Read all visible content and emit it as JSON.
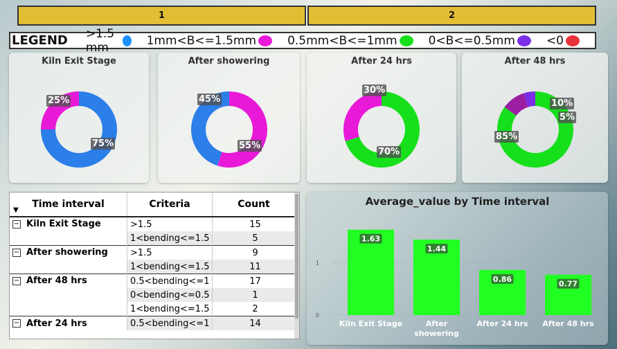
{
  "tabs": [
    "1",
    "2"
  ],
  "legend": {
    "title": "LEGEND",
    "items": [
      {
        "label": ">1.5 mm",
        "color": "#1e90ff",
        "icon": "blue-dot-icon"
      },
      {
        "label": "1mm<B<=1.5mm",
        "color": "#e81ad8",
        "icon": "magenta-dot-icon"
      },
      {
        "label": "0.5mm<B<=1mm",
        "color": "#16e01b",
        "icon": "green-dot-icon"
      },
      {
        "label": "0<B<=0.5mm",
        "color": "#7b2ee6",
        "icon": "purple-dot-icon"
      },
      {
        "label": "<0",
        "color": "#e8323c",
        "icon": "red-dot-icon"
      }
    ]
  },
  "donuts": [
    {
      "title": "Kiln Exit Stage",
      "slices": [
        {
          "value": 75,
          "label": "75%",
          "color": "#2c7ee8"
        },
        {
          "value": 25,
          "label": "25%",
          "color": "#e81ad8"
        }
      ]
    },
    {
      "title": "After showering",
      "slices": [
        {
          "value": 55,
          "label": "55%",
          "color": "#e81ad8"
        },
        {
          "value": 45,
          "label": "45%",
          "color": "#2c7ee8"
        }
      ]
    },
    {
      "title": "After 24 hrs",
      "slices": [
        {
          "value": 70,
          "label": "70%",
          "color": "#16e01b"
        },
        {
          "value": 30,
          "label": "30%",
          "color": "#e81ad8"
        }
      ]
    },
    {
      "title": "After 48 hrs",
      "slices": [
        {
          "value": 85,
          "label": "85%",
          "color": "#16e01b"
        },
        {
          "value": 10,
          "label": "10%",
          "color": "#9b1fa0"
        },
        {
          "value": 5,
          "label": "5%",
          "color": "#7b2ee6"
        }
      ]
    }
  ],
  "table": {
    "headers": [
      "Time interval",
      "Criteria",
      "Count"
    ],
    "rows": [
      {
        "group": "Kiln Exit Stage",
        "criteria": ">1.5",
        "count": "15"
      },
      {
        "group": "",
        "criteria": "1<bending<=1.5",
        "count": "5"
      },
      {
        "group": "After showering",
        "criteria": ">1.5",
        "count": "9"
      },
      {
        "group": "",
        "criteria": "1<bending<=1.5",
        "count": "11"
      },
      {
        "group": "After 48 hrs",
        "criteria": "0.5<bending<=1",
        "count": "17"
      },
      {
        "group": "",
        "criteria": "0<bending<=0.5",
        "count": "1"
      },
      {
        "group": "",
        "criteria": "1<bending<=1.5",
        "count": "2"
      },
      {
        "group": "After 24 hrs",
        "criteria": "0.5<bending<=1",
        "count": "14"
      }
    ]
  },
  "chart_data": {
    "type": "bar",
    "title": "Average_value by Time interval",
    "categories": [
      "Kiln Exit Stage",
      "After showering",
      "After 24 hrs",
      "After 48 hrs"
    ],
    "values": [
      1.63,
      1.44,
      0.86,
      0.77
    ],
    "data_labels": [
      "1.63",
      "1.44",
      "0.86",
      "0.77"
    ],
    "yticks": [
      "0",
      "1"
    ],
    "ylim": [
      0,
      1.85
    ],
    "bar_color": "#22ff22",
    "grid": true
  }
}
